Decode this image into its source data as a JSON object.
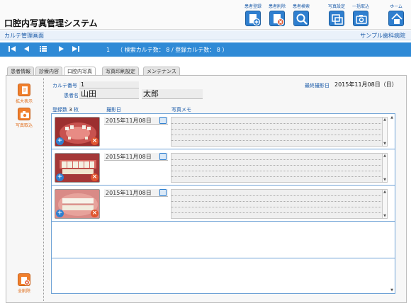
{
  "app": {
    "title": "口腔内写真管理システム",
    "subtitle": "カルテ管理画面",
    "clinic": "サンプル歯科病院"
  },
  "top_buttons": [
    {
      "label": "患者登録",
      "icon": "patient-register-icon"
    },
    {
      "label": "患者削除",
      "icon": "patient-delete-icon"
    },
    {
      "label": "患者検索",
      "icon": "search-icon"
    },
    {
      "label": "写真設定",
      "icon": "photo-settings-icon"
    },
    {
      "label": "一括取込",
      "icon": "bulk-import-icon"
    },
    {
      "label": "ホーム",
      "icon": "home-icon"
    }
  ],
  "nav": {
    "record_index": "1",
    "search_label": "（ 検索カルテ数：",
    "search_count": "8",
    "registered_label": "/ 登録カルテ数：",
    "registered_count": "8 ）"
  },
  "tabs": [
    "患者情報",
    "診療内容",
    "口腔内写真",
    "写真印刷設定",
    "メンテナンス"
  ],
  "active_tab": "口腔内写真",
  "sidebar": {
    "enlarge_label": "拡大表示",
    "import_label": "写真取込",
    "delete_all_label": "全削除"
  },
  "record": {
    "chart_no_label": "カルテ番号",
    "chart_no": "1",
    "patient_name_label": "患者名",
    "last_name": "山田",
    "first_name": "太郎",
    "last_shot_label": "最終撮影日",
    "last_shot_date": "2015年11月08日（日）"
  },
  "list": {
    "count_label": "登録数",
    "count": "3",
    "count_unit": "枚",
    "date_header": "撮影日",
    "memo_header": "写真メモ",
    "rows": [
      {
        "date": "2015年11月08日",
        "memo": ""
      },
      {
        "date": "2015年11月08日",
        "memo": ""
      },
      {
        "date": "2015年11月08日",
        "memo": ""
      }
    ]
  },
  "colors": {
    "accent_blue": "#2f8ad6",
    "label_blue": "#1a5aa8",
    "orange": "#f07f2c"
  }
}
